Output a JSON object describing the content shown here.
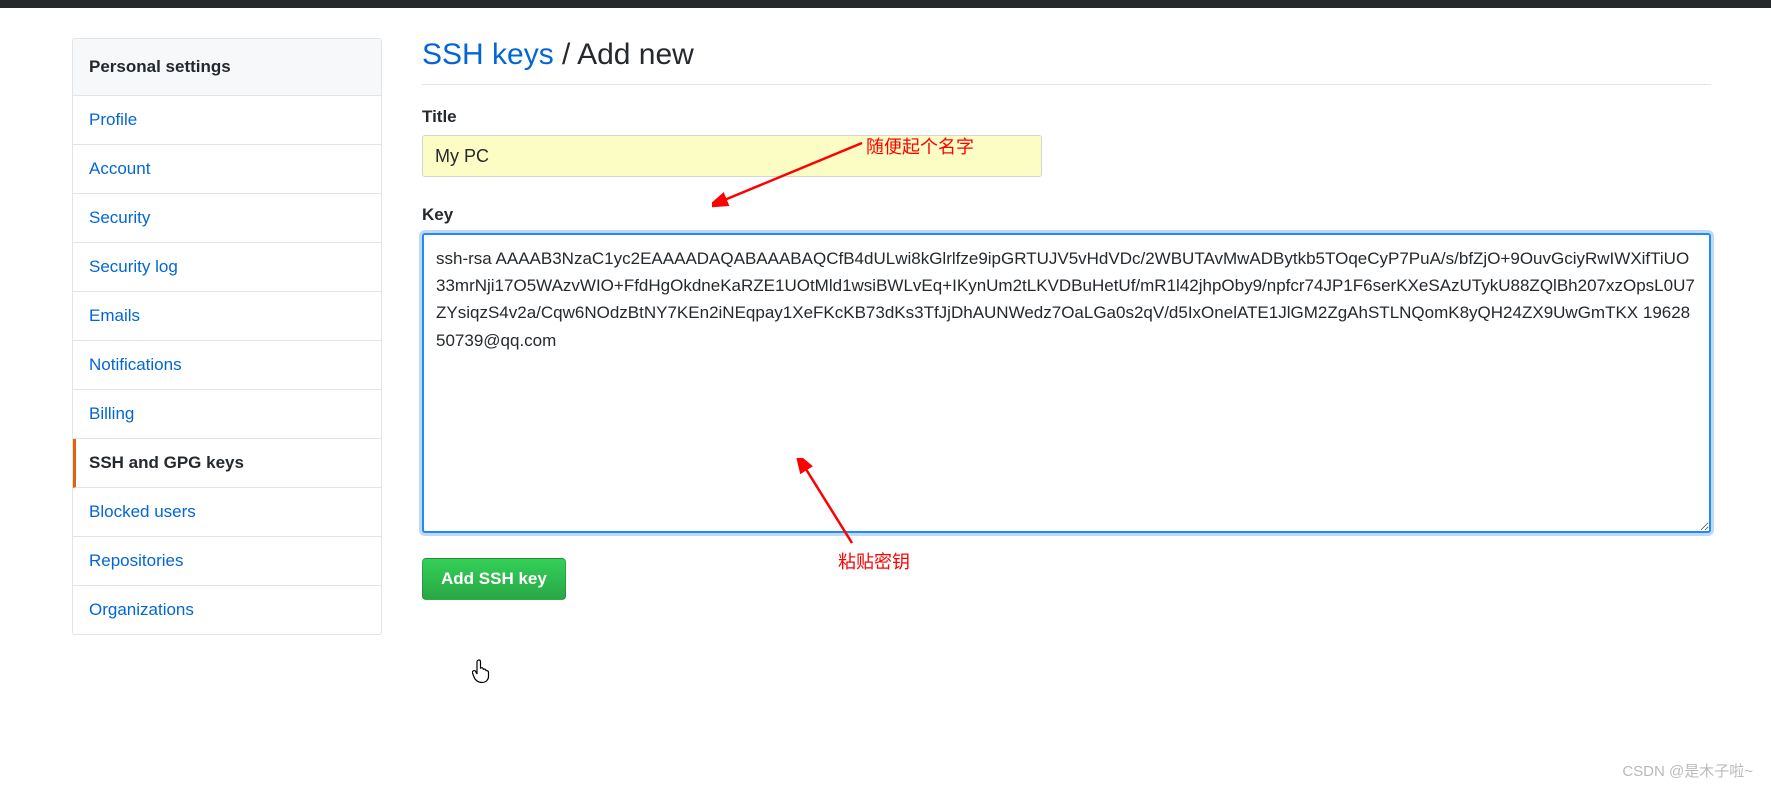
{
  "sidebar": {
    "header": "Personal settings",
    "items": [
      {
        "label": "Profile"
      },
      {
        "label": "Account"
      },
      {
        "label": "Security"
      },
      {
        "label": "Security log"
      },
      {
        "label": "Emails"
      },
      {
        "label": "Notifications"
      },
      {
        "label": "Billing"
      },
      {
        "label": "SSH and GPG keys"
      },
      {
        "label": "Blocked users"
      },
      {
        "label": "Repositories"
      },
      {
        "label": "Organizations"
      }
    ]
  },
  "heading": {
    "link": "SSH keys",
    "sep": " / ",
    "tail": "Add new"
  },
  "form": {
    "title_label": "Title",
    "title_value": "My PC",
    "key_label": "Key",
    "key_value": "ssh-rsa AAAAB3NzaC1yc2EAAAADAQABAAABAQCfB4dULwi8kGlrlfze9ipGRTUJV5vHdVDc/2WBUTAvMwADBytkb5TOqeCyP7PuA/s/bfZjO+9OuvGciyRwIWXifTiUO33mrNji17O5WAzvWIO+FfdHgOkdneKaRZE1UOtMld1wsiBWLvEq+IKynUm2tLKVDBuHetUf/mR1l42jhpOby9/npfcr74JP1F6serKXeSAzUTykU88ZQlBh207xzOpsL0U7ZYsiqzS4v2a/Cqw6NOdzBtNY7KEn2iNEqpay1XeFKcKB73dKs3TfJjDhAUNWedz7OaLGa0s2qV/d5IxOnelATE1JlGM2ZgAhSTLNQomK8yQH24ZX9UwGmTKX 1962850739@qq.com",
    "submit_label": "Add SSH key"
  },
  "annotations": {
    "title_hint": "随便起个名字",
    "key_hint": "粘贴密钥"
  },
  "watermark": "CSDN @是木子啦~"
}
